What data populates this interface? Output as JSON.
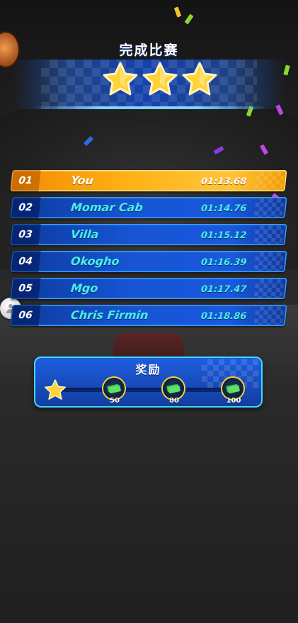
{
  "banner": {
    "title": "完成比赛",
    "stars_earned": 3,
    "stars_total": 3
  },
  "results": [
    {
      "rank": "01",
      "name": "You",
      "time": "01:13.68",
      "is_player": true
    },
    {
      "rank": "02",
      "name": "Momar Cab",
      "time": "01:14.76",
      "is_player": false
    },
    {
      "rank": "03",
      "name": "Villa",
      "time": "01:15.12",
      "is_player": false
    },
    {
      "rank": "04",
      "name": "Okogho",
      "time": "01:16.39",
      "is_player": false
    },
    {
      "rank": "05",
      "name": "Mgo",
      "time": "01:17.47",
      "is_player": false
    },
    {
      "rank": "06",
      "name": "Chris Firmin",
      "time": "01:18.86",
      "is_player": false
    }
  ],
  "reward": {
    "title": "奖励",
    "progress_fraction": 0,
    "milestones": [
      {
        "amount": "50",
        "icon": "cash-icon"
      },
      {
        "amount": "80",
        "icon": "cash-icon"
      },
      {
        "amount": "100",
        "icon": "cash-icon"
      }
    ]
  },
  "colors": {
    "player_row": "#ffb31a",
    "opponent_row": "#1755d6",
    "name_text": "#49f0e6",
    "panel_border": "#3fd7ff",
    "star": "#ffd23a"
  }
}
